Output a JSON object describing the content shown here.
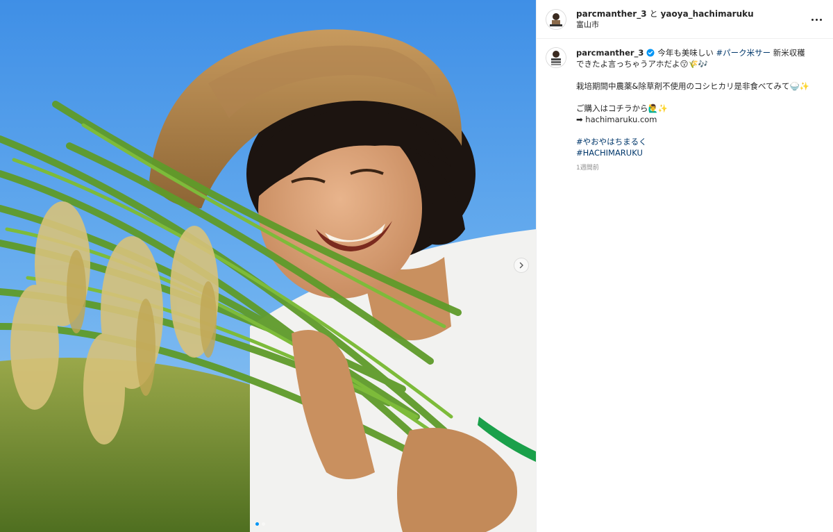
{
  "header": {
    "username": "parcmanther_3",
    "joiner": "と",
    "collaborator": "yaoya_hachimaruku",
    "location": "富山市"
  },
  "icons": {
    "more": "more-options-icon",
    "next": "chevron-right-icon",
    "verified": "verified-badge-icon",
    "avatar": "profile-avatar"
  },
  "colors": {
    "link": "#00376b",
    "verified": "#0095f6",
    "secondary_text": "#8e8e8e"
  },
  "caption": {
    "username": "parcmanther_3",
    "line1_pre": "今年も美味しい ",
    "line1_hashtag": "#パーク米サー",
    "line1_post": " 新米収穫できたよ言っちゃうアホだよ😗🌾🎶",
    "line2": "栽培期間中農薬&除草剤不使用のコシヒカリ是非食べてみて🍚✨",
    "line3": "ご購入はコチラから🙋‍♂️✨",
    "line4": "➡ hachimaruku.com",
    "hashtag1": "#やおやはちまるく",
    "hashtag2": "#HACHIMARUKU",
    "timestamp": "1週間前"
  },
  "carousel": {
    "current_index": 1,
    "total": 2
  }
}
